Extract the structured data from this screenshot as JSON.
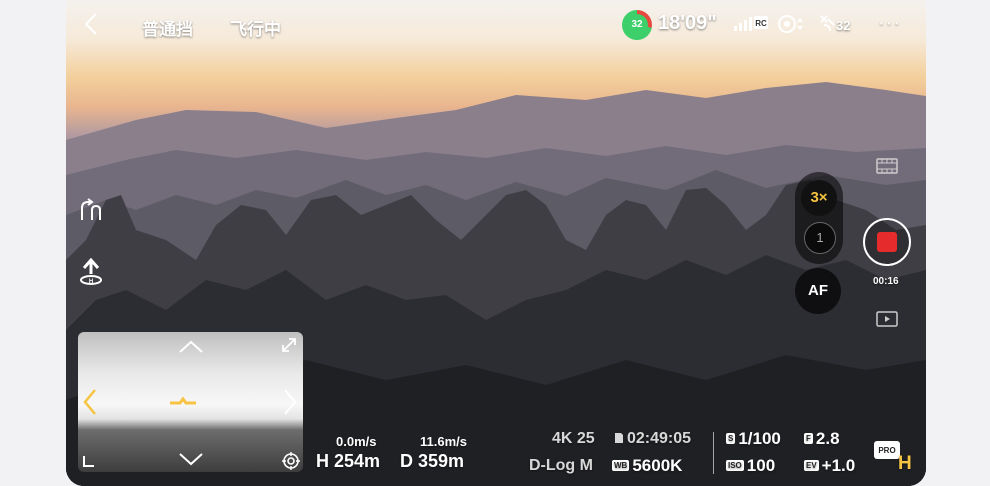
{
  "topbar": {
    "back_icon": "chevron-left-icon",
    "flight_mode": "普通挡",
    "flight_status": "飞行中",
    "battery_percent": "32",
    "flight_time": "18'09\"",
    "signal_badge": "RC",
    "satellite_count": "32",
    "more_icon": "···"
  },
  "camera": {
    "zoom_active": "3×",
    "zoom_alt": "1",
    "af_label": "AF",
    "record_time": "00:16"
  },
  "telemetry": {
    "vertical_speed": "0.0m/s",
    "horizontal_speed": "11.6m/s",
    "height": "H 254m",
    "distance": "D 359m"
  },
  "recording": {
    "resolution": "4K 25",
    "remaining_time": "02:49:05",
    "color_profile": "D-Log M",
    "white_balance_tag": "WB",
    "white_balance": "5600K"
  },
  "exposure": {
    "shutter_tag": "S",
    "shutter": "1/100",
    "aperture_tag": "F",
    "aperture": "2.8",
    "iso_tag": "ISO",
    "iso": "100",
    "ev_tag": "EV",
    "ev": "+1.0",
    "pro_label": "PRO",
    "mode_label": "H"
  },
  "colors": {
    "accent_yellow": "#f6c342",
    "record_red": "#e52b2b",
    "battery_green": "#3ccf6a",
    "battery_red": "#e64a3f"
  }
}
